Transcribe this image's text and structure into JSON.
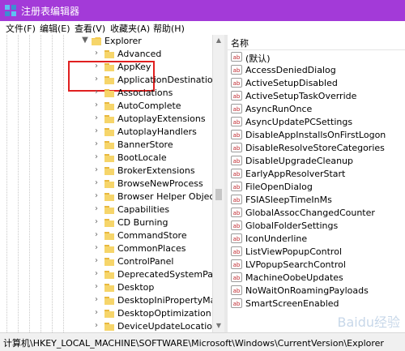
{
  "window": {
    "title": "注册表编辑器",
    "accent": "#a33ad8"
  },
  "menu": [
    "文件(F)",
    "编辑(E)",
    "查看(V)",
    "收藏夹(A)",
    "帮助(H)"
  ],
  "tree": {
    "expanded_key": "Explorer",
    "children": [
      "Advanced",
      "AppKey",
      "ApplicationDestinations",
      "Associations",
      "AutoComplete",
      "AutoplayExtensions",
      "AutoplayHandlers",
      "BannerStore",
      "BootLocale",
      "BrokerExtensions",
      "BrowseNewProcess",
      "Browser Helper Objects",
      "Capabilities",
      "CD Burning",
      "CommandStore",
      "CommonPlaces",
      "ControlPanel",
      "DeprecatedSystemPackag",
      "Desktop",
      "DesktopIniPropertyMap",
      "DesktopOptimization",
      "DeviceUpdateLocations"
    ]
  },
  "values": {
    "column_header": "名称",
    "items": [
      "(默认)",
      "AccessDeniedDialog",
      "ActiveSetupDisabled",
      "ActiveSetupTaskOverride",
      "AsyncRunOnce",
      "AsyncUpdatePCSettings",
      "DisableAppInstallsOnFirstLogon",
      "DisableResolveStoreCategories",
      "DisableUpgradeCleanup",
      "EarlyAppResolverStart",
      "FileOpenDialog",
      "FSIASleepTimeInMs",
      "GlobalAssocChangedCounter",
      "GlobalFolderSettings",
      "IconUnderline",
      "ListViewPopupControl",
      "LVPopupSearchControl",
      "MachineOobeUpdates",
      "NoWaitOnRoamingPayloads",
      "SmartScreenEnabled"
    ]
  },
  "status_path": "计算机\\HKEY_LOCAL_MACHINE\\SOFTWARE\\Microsoft\\Windows\\CurrentVersion\\Explorer",
  "watermark": "Baidu经验"
}
